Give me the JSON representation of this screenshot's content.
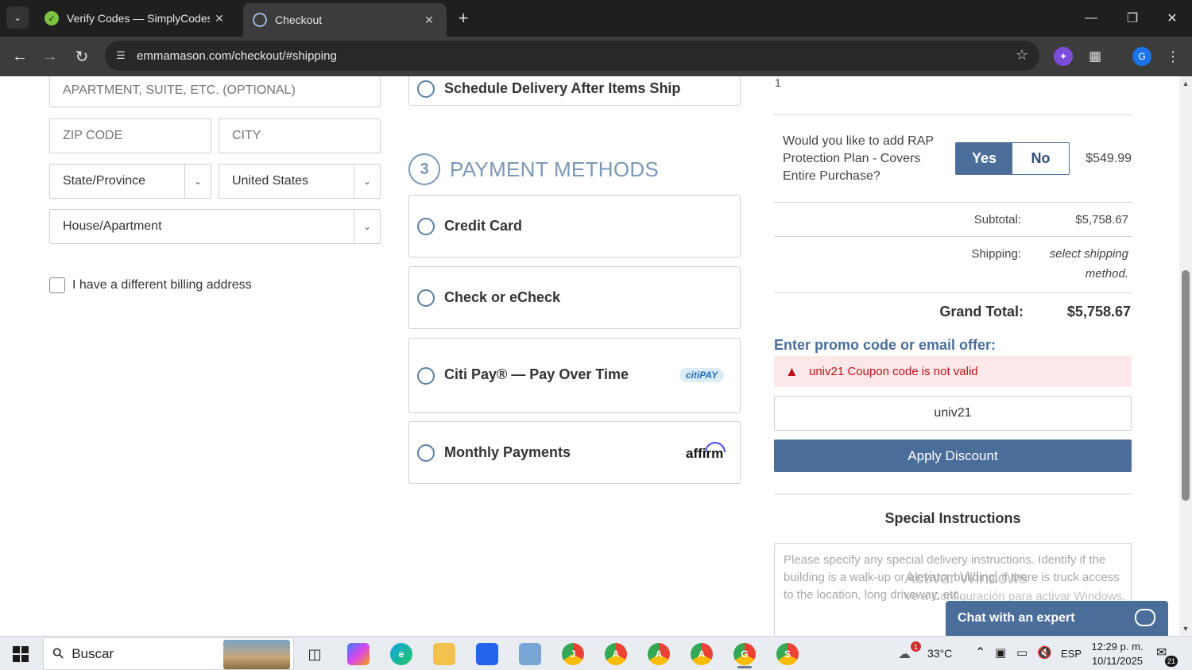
{
  "browser": {
    "tabs": [
      {
        "title": "Verify Codes — SimplyCodes",
        "active": false,
        "icon": "simplycodes-check-icon"
      },
      {
        "title": "Checkout",
        "active": true,
        "icon": "site-gear-icon"
      }
    ],
    "url": "emmamason.com/checkout/#shipping",
    "profile_initial": "G"
  },
  "shipping_form": {
    "apartment_placeholder": "APARTMENT, SUITE, ETC. (OPTIONAL)",
    "zip_placeholder": "ZIP CODE",
    "city_placeholder": "CITY",
    "state_value": "State/Province",
    "country_value": "United States",
    "address_type_value": "House/Apartment",
    "billing_checkbox_label": "I have a different billing address",
    "billing_checked": false
  },
  "delivery": {
    "schedule_option": "Schedule Delivery After Items Ship"
  },
  "payment": {
    "step_number": "3",
    "title": "PAYMENT METHODS",
    "methods": [
      {
        "label": "Credit Card",
        "logo": ""
      },
      {
        "label": "Check or eCheck",
        "logo": ""
      },
      {
        "label": "Citi Pay® — Pay Over Time",
        "logo": "citiPAY"
      },
      {
        "label": "Monthly Payments",
        "logo": "affirm"
      }
    ]
  },
  "summary": {
    "quantity": "1",
    "protection_question": "Would you like to add RAP Protection Plan - Covers Entire Purchase?",
    "yes_label": "Yes",
    "no_label": "No",
    "protection_selected": "Yes",
    "protection_price": "$549.99",
    "subtotal_label": "Subtotal:",
    "subtotal_value": "$5,758.67",
    "shipping_label": "Shipping:",
    "shipping_value_line1": "select shipping",
    "shipping_value_line2": "method.",
    "grand_total_label": "Grand Total:",
    "grand_total_value": "$5,758.67"
  },
  "promo": {
    "heading": "Enter promo code or email offer:",
    "error": "univ21 Coupon code is not valid",
    "code_value": "univ21",
    "apply_label": "Apply Discount"
  },
  "special_instructions": {
    "heading": "Special Instructions",
    "placeholder": "Please specify any special delivery instructions. Identify if the building is a walk-up or elevator building, if there is truck access to the location, long driveway, etc."
  },
  "watermark": {
    "line1": "Activar Windows",
    "line2": "Ve a Configuración para activar Windows."
  },
  "chat": {
    "label": "Chat with an expert"
  },
  "taskbar": {
    "search_label": "Buscar",
    "temperature": "33°C",
    "language": "ESP",
    "time": "12:29 p. m.",
    "date": "10/11/2025",
    "notification_count": "21",
    "weather_badge": "1"
  },
  "colors": {
    "accent": "#4a6d9a",
    "section_title": "#7b98b8",
    "error_text": "#c0141c",
    "error_bg": "#fce8e8"
  }
}
